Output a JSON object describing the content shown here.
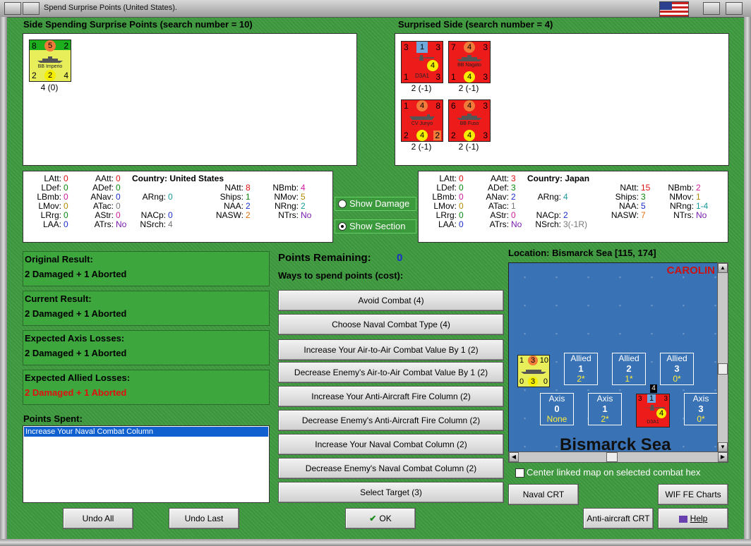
{
  "window": {
    "title": "Spend Surprise Points (United States)."
  },
  "spending": {
    "header": "Side Spending Surprise Points (search number = 10)",
    "counters": [
      {
        "name": "BB Imperio",
        "tl": "8",
        "tc": "5",
        "tr": "2",
        "bl": "2",
        "bc": "2",
        "br": "4",
        "label": "4 (0)"
      }
    ]
  },
  "surprised": {
    "header": "Surprised Side (search number = 4)",
    "counters": [
      {
        "name": "D3A1",
        "tl": "3",
        "tc": "1",
        "tr": "3",
        "bl": "1",
        "bc": "4",
        "br": "3",
        "label": "2 (-1)"
      },
      {
        "name": "BB Nagato",
        "tl": "7",
        "tc": "4",
        "tr": "3",
        "bl": "1",
        "bc": "4",
        "br": "3",
        "label": "2 (-1)"
      },
      {
        "name": "CV Junyo",
        "tl": "1",
        "tc": "4",
        "tr": "8",
        "bl": "2",
        "bc": "4",
        "br": "2",
        "label": "2 (-1)"
      },
      {
        "name": "BB Fuso",
        "tl": "6",
        "tc": "4",
        "tr": "3",
        "bl": "2",
        "bc": "4",
        "br": "3",
        "label": "2 (-1)"
      }
    ]
  },
  "stats_us": {
    "country_label": "Country:",
    "country": "United States",
    "latt": "0",
    "ldef": "0",
    "lbmb": "0",
    "lmov": "0",
    "lrng": "0",
    "laa": "0",
    "aatt": "0",
    "adef": "0",
    "anav": "0",
    "atac": "0",
    "astr": "0",
    "atrs": "No",
    "arng": "0",
    "nacp": "0",
    "nsrch": "4",
    "natt": "8",
    "ships": "1",
    "naa": "2",
    "nasw": "2",
    "nbmb": "4",
    "nmov": "5",
    "nrng": "2",
    "ntrs": "No"
  },
  "stats_jp": {
    "country_label": "Country:",
    "country": "Japan",
    "latt": "0",
    "ldef": "0",
    "lbmb": "0",
    "lmov": "0",
    "lrng": "0",
    "laa": "0",
    "aatt": "3",
    "adef": "3",
    "anav": "2",
    "atac": "1",
    "astr": "0",
    "atrs": "No",
    "arng": "4",
    "nacp": "2",
    "nsrch": "3(-1R)",
    "natt": "15",
    "ships": "3",
    "naa": "5",
    "nasw": "7",
    "nbmb": "2",
    "nmov": "1",
    "nrng": "1-4",
    "ntrs": "No"
  },
  "toggles": {
    "show_damage": "Show Damage",
    "show_section": "Show Section"
  },
  "results": {
    "original_title": "Original Result:",
    "original_value": "2 Damaged + 1 Aborted",
    "current_title": "Current Result:",
    "current_value": "2 Damaged + 1 Aborted",
    "axis_title": "Expected Axis Losses:",
    "axis_value": "2 Damaged + 1 Aborted",
    "allied_title": "Expected Allied Losses:",
    "allied_value": "2 Damaged + 1 Aborted"
  },
  "points_spent": {
    "label": "Points Spent:",
    "items": [
      "Increase Your Naval Combat Column"
    ]
  },
  "points": {
    "remaining_label": "Points Remaining:",
    "remaining": "0",
    "ways_label": "Ways to spend points (cost):"
  },
  "ways": [
    "Avoid Combat (4)",
    "Choose Naval Combat Type (4)",
    "Increase Your Air-to-Air Combat Value By 1 (2)",
    "Decrease Enemy's Air-to-Air Combat Value By 1 (2)",
    "Increase Your Anti-Aircraft Fire Column (2)",
    "Decrease Enemy's Anti-Aircraft Fire Column (2)",
    "Increase Your Naval Combat Column (2)",
    "Decrease Enemy's Naval Combat Column (2)",
    "Select Target (3)"
  ],
  "location": {
    "label": "Location: Bismarck Sea [115, 174]"
  },
  "map": {
    "region_top": "CAROLIN",
    "sea_name": "Bismarck Sea",
    "allied_zones": [
      {
        "side": "Allied",
        "num": "1",
        "val": "2*"
      },
      {
        "side": "Allied",
        "num": "2",
        "val": "1*"
      },
      {
        "side": "Allied",
        "num": "3",
        "val": "0*"
      }
    ],
    "axis_zones": [
      {
        "side": "Axis",
        "num": "0",
        "val": "None"
      },
      {
        "side": "Axis",
        "num": "1",
        "val": "2*"
      },
      {
        "side": "Axis",
        "num": "3",
        "val": "0*"
      }
    ],
    "stack_count": "4",
    "allied_counter": {
      "tl": "1",
      "tc": "3",
      "tr": "10",
      "bl": "0",
      "bc": "3",
      "br": "0"
    },
    "axis_counter": {
      "tl": "3",
      "tc": "1",
      "tr": "3",
      "bc": "4",
      "name": "D3A1"
    }
  },
  "center_map": {
    "label": "Center linked map on selected combat hex"
  },
  "buttons": {
    "naval_crt": "Naval CRT",
    "wif_charts": "WIF FE Charts",
    "aa_crt": "Anti-aircraft CRT",
    "help": "Help",
    "undo_all": "Undo All",
    "undo_last": "Undo Last",
    "ok": "OK"
  }
}
